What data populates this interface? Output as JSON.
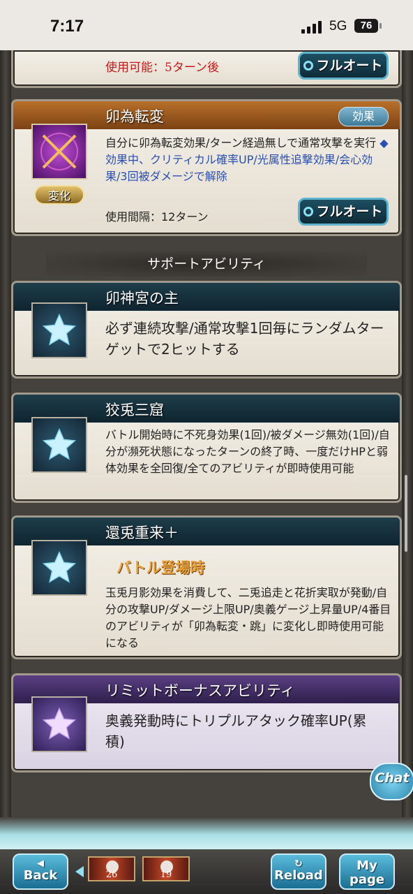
{
  "status_bar": {
    "time": "7:17",
    "network": "5G",
    "battery": "76"
  },
  "card_prev": {
    "usable_text": "使用可能：5ターン後",
    "button_label": "フルオート"
  },
  "ability": {
    "name": "卯為転変",
    "badge": "効果",
    "change_badge": "変化",
    "desc_part1": "自分に卯為転変効果/ターン経過無しで通常攻撃を実行",
    "desc_part2": "◆効果中、クリティカル確率UP/光属性追撃効果/会心効果/3回被ダメージで解除",
    "interval": "使用間隔：12ターン",
    "button_label": "フルオート"
  },
  "section_heading": "サポートアビリティ",
  "support_abilities": [
    {
      "name": "卯神宮の主",
      "desc": "必ず連続攻撃/通常攻撃1回毎にランダムターゲットで2ヒットする"
    },
    {
      "name": "狡兎三窟",
      "desc": "バトル開始時に不死身効果(1回)/被ダメージ無効(1回)/自分が瀕死状態になったターンの終了時、一度だけHPと弱体効果を全回復/全てのアビリティが即時使用可能"
    },
    {
      "name": "還兎重来＋",
      "tag": "バトル登場時",
      "desc": "玉兎月影効果を消費して、二兎追走と花折実取が発動/自分の攻撃UP/ダメージ上限UP/奥義ゲージ上昇量UP/4番目のアビリティが「卯為転変・跳」に変化し即時使用可能になる"
    }
  ],
  "limit_bonus": {
    "name": "リミットボーナスアビリティ",
    "desc": "奥義発動時にトリプルアタック確率UP(累積)"
  },
  "chat_label": "Chat",
  "nav": {
    "back_line1": "◀",
    "back_line2": "Back",
    "thumb1": "26",
    "thumb2": "19",
    "reload_line1": "↻",
    "reload_line2": "Reload",
    "mypage_line1": "My",
    "mypage_line2": "page"
  }
}
